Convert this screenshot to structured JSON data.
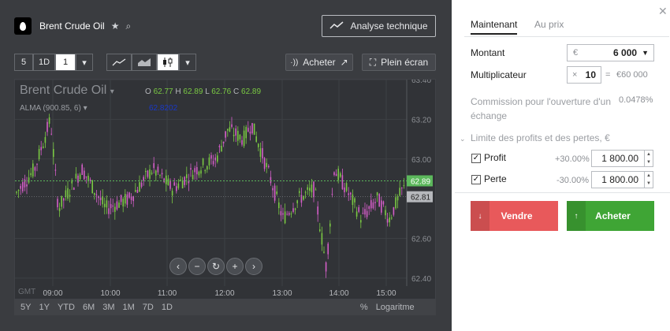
{
  "instrument": {
    "name": "Brent Crude Oil",
    "star_icon": "star-icon",
    "search_icon": "search-icon"
  },
  "header": {
    "ta_label": "Analyse technique"
  },
  "toolbar": {
    "intervals": [
      "5",
      "1D",
      "1"
    ],
    "buy_label": "Acheter",
    "fullscreen_label": "Plein écran"
  },
  "chart_header": {
    "title": "Brent Crude Oil",
    "o_label": "O",
    "o": "62.77",
    "h_label": "H",
    "h": "62.89",
    "l_label": "L",
    "l": "62.76",
    "c_label": "C",
    "c": "62.89",
    "alma": "ALMA (900.85, 6)",
    "alma_value": "62.8202",
    "gmt": "GMT"
  },
  "chart_data": {
    "type": "candlestick",
    "x_ticks": [
      "09:00",
      "10:00",
      "11:00",
      "12:00",
      "13:00",
      "14:00",
      "15:00"
    ],
    "y_ticks": [
      "63.40",
      "63.20",
      "63.00",
      "62.60",
      "62.40"
    ],
    "ylim": [
      62.36,
      63.4
    ],
    "last_price_label": "62.89",
    "alma_line_label": "62.81",
    "last_price": 62.89,
    "alma_level": 62.81,
    "colors": {
      "up": "#7ac943",
      "down": "#d45ec8",
      "last": "#5cb85c",
      "alma": "#b6b8bc"
    }
  },
  "timeframes": [
    "5Y",
    "1Y",
    "YTD",
    "6M",
    "3M",
    "1M",
    "7D",
    "1D"
  ],
  "scale_options": [
    "%",
    "Logaritme"
  ],
  "panel": {
    "tab_now": "Maintenant",
    "tab_price": "Au prix",
    "montant_label": "Montant",
    "currency": "€",
    "montant_value": "6 000",
    "mult_label": "Multiplicateur",
    "mult_x": "×",
    "mult_value": "10",
    "mult_eq": "=",
    "mult_total": "€60 000",
    "commission_label": "Commission pour l'ouverture d'un échange",
    "commission_value": "0.0478%",
    "limits_label": "Limite des profits et des pertes, €",
    "profit_label": "Profit",
    "profit_pct": "+30.00%",
    "profit_value": "1 800.00",
    "loss_label": "Perte",
    "loss_pct": "-30.00%",
    "loss_value": "1 800.00",
    "sell_label": "Vendre",
    "buy_label": "Acheter",
    "sell_color": "#e8595b",
    "buy_color": "#3fa535"
  }
}
